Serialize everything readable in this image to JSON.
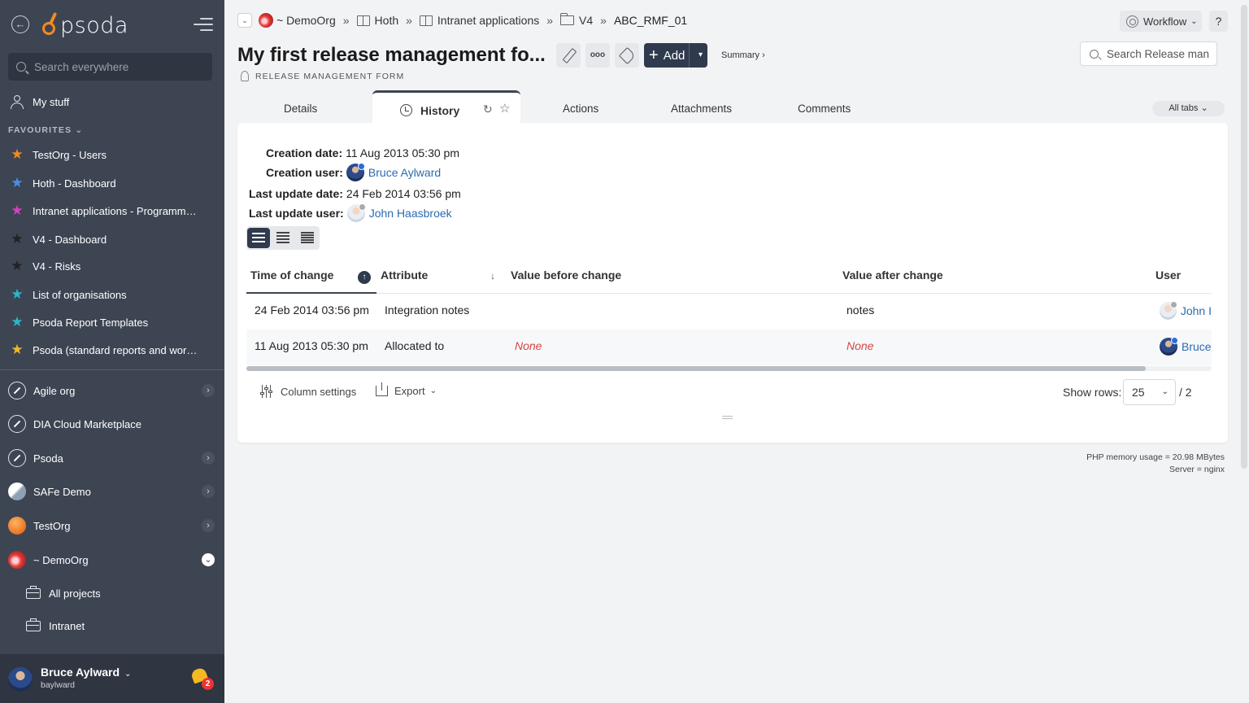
{
  "sidebar": {
    "logo_text": "psoda",
    "search_placeholder": "Search everywhere",
    "my_stuff": "My stuff",
    "favourites_heading": "FAVOURITES",
    "favourites": [
      {
        "label": "TestOrg - Users",
        "color": "#f08a24"
      },
      {
        "label": "Hoth - Dashboard",
        "color": "#4a8fe7"
      },
      {
        "label": "Intranet applications - Programme...",
        "color": "#d63fc5"
      },
      {
        "label": "V4 - Dashboard",
        "color": "#222222"
      },
      {
        "label": "V4 - Risks",
        "color": "#222222"
      },
      {
        "label": "List of organisations",
        "color": "#2cb5c9"
      },
      {
        "label": "Psoda Report Templates",
        "color": "#2cb5c9"
      },
      {
        "label": "Psoda (standard reports and work...",
        "color": "#f5b820"
      }
    ],
    "orgs": [
      {
        "label": "Agile org",
        "logo": "blue",
        "chevron": ">"
      },
      {
        "label": "DIA Cloud Marketplace",
        "logo": "blue",
        "chevron": ""
      },
      {
        "label": "Psoda",
        "logo": "blue",
        "chevron": ">"
      },
      {
        "label": "SAFe Demo",
        "logo": "safe",
        "chevron": ">"
      },
      {
        "label": "TestOrg",
        "logo": "test",
        "chevron": ">"
      },
      {
        "label": "~ DemoOrg",
        "logo": "demo",
        "chevron": "v"
      }
    ],
    "projects": [
      {
        "label": "All projects"
      },
      {
        "label": "Intranet"
      }
    ],
    "user": {
      "name": "Bruce Aylward",
      "handle": "baylward",
      "notifications": "2"
    }
  },
  "breadcrumb": {
    "org": "~ DemoOrg",
    "items": [
      "Hoth",
      "Intranet applications",
      "V4",
      "ABC_RMF_01"
    ],
    "separator": "»"
  },
  "header": {
    "workflow_label": "Workflow",
    "help_label": "?",
    "title": "My first release management fo...",
    "subtitle": "RELEASE MANAGEMENT FORM",
    "add_label": "Add",
    "summary_label": "Summary ›",
    "search_placeholder": "Search Release man"
  },
  "tabs": {
    "items": [
      "Details",
      "History",
      "Actions",
      "Attachments",
      "Comments"
    ],
    "active": "History",
    "all_tabs_label": "All tabs"
  },
  "history": {
    "creation_date_label": "Creation date:",
    "creation_date": "11 Aug 2013 05:30 pm",
    "creation_user_label": "Creation user:",
    "creation_user": "Bruce Aylward",
    "last_update_date_label": "Last update date:",
    "last_update_date": "24 Feb 2014 03:56 pm",
    "last_update_user_label": "Last update user:",
    "last_update_user": "John Haasbroek",
    "columns": [
      "Time of change",
      "Attribute",
      "Value before change",
      "Value after change",
      "User"
    ],
    "rows": [
      {
        "time": "24 Feb 2014 03:56 pm",
        "attribute": "Integration notes",
        "before": "",
        "after": "notes",
        "user": "John Haasbroek",
        "user_short": "John I"
      },
      {
        "time": "11 Aug 2013 05:30 pm",
        "attribute": "Allocated to",
        "before": "None",
        "after": "None",
        "user": "Bruce Aylward",
        "user_short": "Bruce"
      }
    ],
    "column_settings_label": "Column settings",
    "export_label": "Export",
    "show_rows_label": "Show rows:",
    "rows_per_page": "25",
    "pages": "/ 2"
  },
  "footer": {
    "memory": "PHP memory usage = 20.98 MBytes",
    "server": "Server = nginx"
  }
}
